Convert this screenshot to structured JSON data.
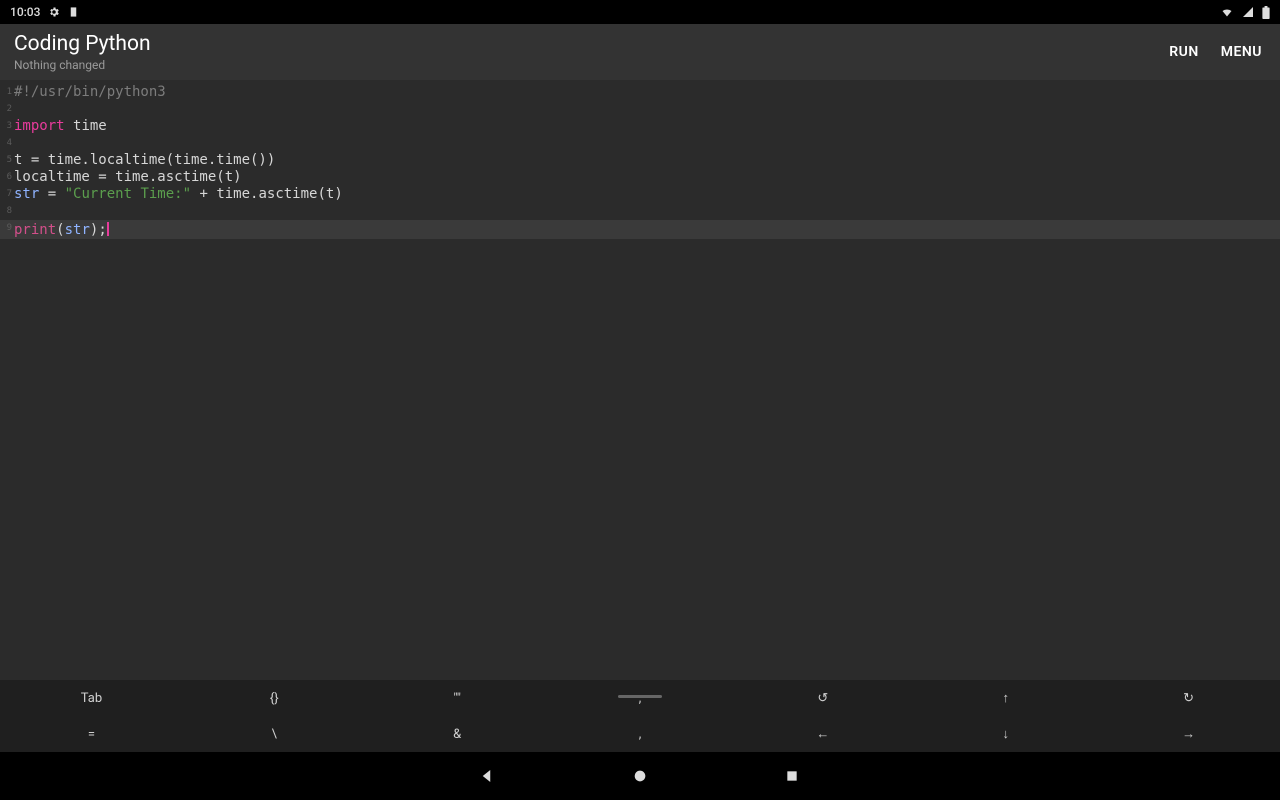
{
  "status": {
    "time": "10:03",
    "icons_left": [
      "gear-icon",
      "notification-icon"
    ],
    "icons_right": [
      "wifi-icon",
      "signal-icon",
      "battery-icon"
    ]
  },
  "titlebar": {
    "title": "Coding Python",
    "subtitle": "Nothing changed",
    "run_label": "RUN",
    "menu_label": "MENU"
  },
  "code_lines": [
    {
      "n": 1,
      "tokens": [
        {
          "c": "comment",
          "t": "#!/usr/bin/python3"
        }
      ]
    },
    {
      "n": 2,
      "tokens": []
    },
    {
      "n": 3,
      "tokens": [
        {
          "c": "kw",
          "t": "import"
        },
        {
          "c": "op",
          "t": " "
        },
        {
          "c": "ident",
          "t": "time"
        }
      ]
    },
    {
      "n": 4,
      "tokens": []
    },
    {
      "n": 5,
      "tokens": [
        {
          "c": "ident",
          "t": "t = time.localtime(time.time())"
        }
      ]
    },
    {
      "n": 6,
      "tokens": [
        {
          "c": "ident",
          "t": "localtime = time.asctime(t)"
        }
      ]
    },
    {
      "n": 7,
      "tokens": [
        {
          "c": "builtin",
          "t": "str"
        },
        {
          "c": "ident",
          "t": " = "
        },
        {
          "c": "str",
          "t": "\"Current Time:\""
        },
        {
          "c": "ident",
          "t": " + time.asctime(t)"
        }
      ]
    },
    {
      "n": 8,
      "tokens": []
    },
    {
      "n": 9,
      "cursor": true,
      "tokens": [
        {
          "c": "func",
          "t": "print"
        },
        {
          "c": "ident",
          "t": "("
        },
        {
          "c": "builtin",
          "t": "str"
        },
        {
          "c": "ident",
          "t": ");"
        }
      ]
    }
  ],
  "extra_keys": {
    "row1": [
      "Tab",
      "{}",
      "\"\"",
      ";",
      "↺",
      "↑",
      "↻"
    ],
    "row2": [
      "=",
      "\\",
      "&",
      ",",
      "←",
      "↓",
      "→"
    ]
  },
  "nav": {
    "back": "back-icon",
    "home": "home-icon",
    "recents": "recents-icon"
  }
}
